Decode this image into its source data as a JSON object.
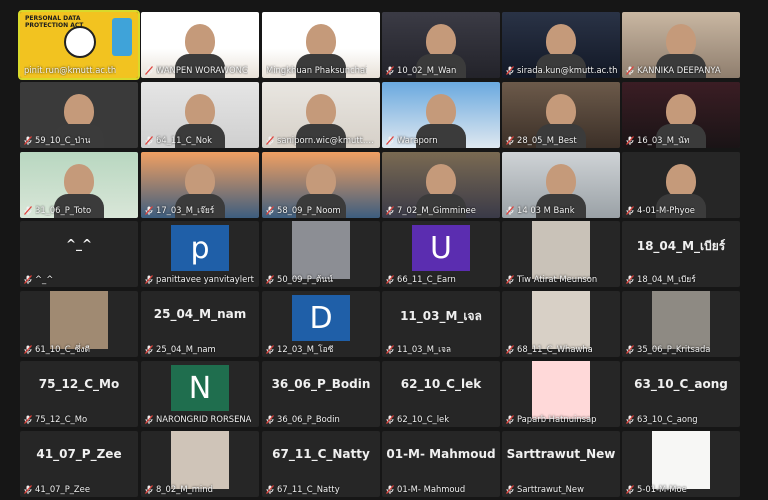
{
  "colors": {
    "background": "#161616",
    "tile": "#262626",
    "active_border": "#d9d92b",
    "mic_off": "#e0413b",
    "avatar_blue": "#1f5fa8",
    "avatar_purple": "#5b2db0",
    "avatar_green": "#1f6e4e"
  },
  "icons": {
    "mic": "microphone-muted-icon"
  },
  "slide_text": {
    "line1": "PERSONAL DATA",
    "line2": "PROTECTION ACT"
  },
  "tiles": [
    {
      "name": "pinit.run@kmutt.ac.th",
      "type": "slide",
      "mic_off": false
    },
    {
      "name": "WANPEN WORAWONG",
      "type": "video",
      "mic_off": true
    },
    {
      "name": "Mingkhuan Phaksunchai",
      "type": "video",
      "mic_off": false
    },
    {
      "name": "10_02_M_Wan",
      "type": "video",
      "mic_off": true
    },
    {
      "name": "sirada.kun@kmutt.ac.th",
      "type": "video",
      "mic_off": true
    },
    {
      "name": "KANNIKA DEEPANYA",
      "type": "video",
      "mic_off": true
    },
    {
      "name": "59_10_C_ป่าน",
      "type": "video",
      "mic_off": true
    },
    {
      "name": "64_11_C_Nok",
      "type": "video",
      "mic_off": true
    },
    {
      "name": "saniporn.wic@kmutt.a...",
      "type": "video",
      "mic_off": true
    },
    {
      "name": "Waraporn",
      "type": "video",
      "mic_off": true
    },
    {
      "name": "28_05_M_Best",
      "type": "video",
      "mic_off": true
    },
    {
      "name": "16_03_M_นัท",
      "type": "video",
      "mic_off": true
    },
    {
      "name": "31_06_P_Toto",
      "type": "video",
      "mic_off": true
    },
    {
      "name": "17_03_M_เจ๊ยร์",
      "type": "video",
      "mic_off": true
    },
    {
      "name": "58_09_P_Noom",
      "type": "video",
      "mic_off": true
    },
    {
      "name": "7_02_M_Gimminee",
      "type": "video",
      "mic_off": true
    },
    {
      "name": "14 03 M Bank",
      "type": "video",
      "mic_off": true
    },
    {
      "name": "4-01-M-Phyoe",
      "type": "video",
      "mic_off": true
    },
    {
      "name": "^_^",
      "type": "text",
      "label": "^_^",
      "mic_off": true
    },
    {
      "name": "panittavee yanvitaylert",
      "type": "avatar",
      "letter": "p",
      "color": "#1f5fa8",
      "mic_off": true
    },
    {
      "name": "50_09_P_ต้นน์",
      "type": "photo",
      "mic_off": true
    },
    {
      "name": "66_11_C_Earn",
      "type": "avatar",
      "letter": "U",
      "color": "#5b2db0",
      "mic_off": true
    },
    {
      "name": "Tiw Atirat Meunson",
      "type": "photo",
      "mic_off": true
    },
    {
      "name": "18_04_M_เบียร์",
      "type": "text",
      "label": "18_04_M_เบียร์",
      "mic_off": true
    },
    {
      "name": "61_10_C_ซึ่งตี",
      "type": "photo",
      "mic_off": true
    },
    {
      "name": "25_04_M_nam",
      "type": "text",
      "label": "25_04_M_nam",
      "mic_off": true
    },
    {
      "name": "12_03_M_โอซี",
      "type": "avatar",
      "letter": "D",
      "color": "#1f5fa8",
      "mic_off": true
    },
    {
      "name": "11_03_M_เจล",
      "type": "text",
      "label": "11_03_M_เจล",
      "mic_off": true
    },
    {
      "name": "68_11_C_Whawha",
      "type": "photo",
      "mic_off": true
    },
    {
      "name": "35_06_P_Kritsada",
      "type": "photo",
      "mic_off": true
    },
    {
      "name": "75_12_C_Mo",
      "type": "text",
      "label": "75_12_C_Mo",
      "mic_off": true
    },
    {
      "name": "NARONGRID RORSENA",
      "type": "avatar",
      "letter": "N",
      "color": "#1f6e4e",
      "mic_off": true
    },
    {
      "name": "36_06_P_Bodin",
      "type": "text",
      "label": "36_06_P_Bodin",
      "mic_off": true
    },
    {
      "name": "62_10_C_lek",
      "type": "text",
      "label": "62_10_C_lek",
      "mic_off": true
    },
    {
      "name": "Paparb Hatnuinsap",
      "type": "photo",
      "mic_off": true
    },
    {
      "name": "63_10_C_aong",
      "type": "text",
      "label": "63_10_C_aong",
      "mic_off": true
    },
    {
      "name": "41_07_P_Zee",
      "type": "text",
      "label": "41_07_P_Zee",
      "mic_off": true
    },
    {
      "name": "8_02_M_mind",
      "type": "photo",
      "mic_off": true
    },
    {
      "name": "67_11_C_Natty",
      "type": "text",
      "label": "67_11_C_Natty",
      "mic_off": true
    },
    {
      "name": "01-M- Mahmoud",
      "type": "text",
      "label": "01-M- Mahmoud",
      "mic_off": true
    },
    {
      "name": "Sarttrawut_New",
      "type": "text",
      "label": "Sarttrawut_New",
      "mic_off": true
    },
    {
      "name": "5-01-M-Moe",
      "type": "blank",
      "mic_off": true
    }
  ]
}
